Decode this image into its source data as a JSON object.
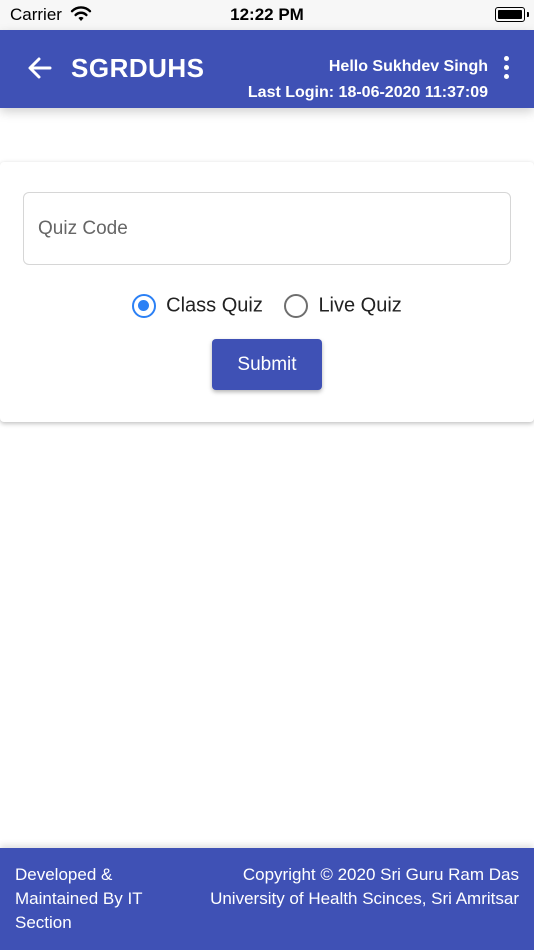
{
  "status_bar": {
    "carrier": "Carrier",
    "time": "12:22 PM"
  },
  "header": {
    "title": "SGRDUHS",
    "greeting": "Hello Sukhdev Singh",
    "last_login": "Last Login: 18-06-2020 11:37:09",
    "back_icon": "arrow-left-icon",
    "menu_icon": "more-vertical-icon"
  },
  "form": {
    "quiz_code_placeholder": "Quiz Code",
    "quiz_code_value": "",
    "options": [
      "Class Quiz",
      "Live Quiz"
    ],
    "selected_option": "Class Quiz",
    "submit_label": "Submit"
  },
  "footer": {
    "left_text": "Developed & Maintained By IT Section",
    "right_text": "Copyright © 2020 Sri Guru Ram Das University of Health Scinces, Sri Amritsar"
  },
  "colors": {
    "primary": "#3f51b5",
    "radio_selected": "#2b80f5"
  }
}
